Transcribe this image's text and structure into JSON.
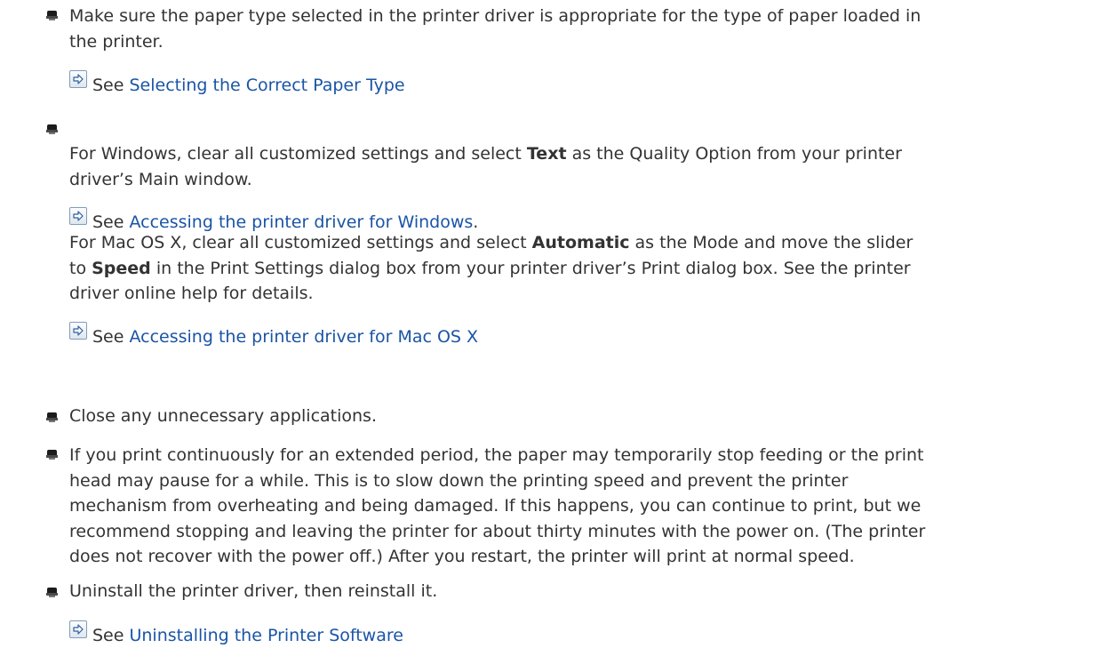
{
  "items": [
    {
      "text_line1": "Make sure the paper type selected in the printer driver is appropriate for the type of paper loaded in",
      "text_line2": "the printer.",
      "see_label": "See ",
      "link": "Selecting the Correct Paper Type"
    },
    {
      "windows_line1_a": "For Windows, clear all customized settings and select ",
      "windows_line1_bold": "Text",
      "windows_line1_b": " as the Quality Option from your printer",
      "windows_line2": "driver’s Main window.",
      "windows_see_label": "See ",
      "windows_link": "Accessing the printer driver for Windows",
      "windows_link_suffix": ".",
      "mac_line1_a": "For Mac OS X, clear all customized settings and select ",
      "mac_line1_bold": "Automatic",
      "mac_line1_b": " as the Mode and move the slider",
      "mac_line2_a": "to ",
      "mac_line2_bold": "Speed",
      "mac_line2_b": " in the Print Settings dialog box from your printer driver’s Print dialog box. See the printer",
      "mac_line3": "driver online help for details.",
      "mac_see_label": "See ",
      "mac_link": "Accessing the printer driver for Mac OS X"
    },
    {
      "text": "Close any unnecessary applications."
    },
    {
      "lines": [
        "If you print continuously for an extended period, the paper may temporarily stop feeding or the print",
        "head may pause for a while. This is to slow down the printing speed and prevent the printer",
        "mechanism from overheating and being damaged. If this happens, you can continue to print, but we",
        "recommend stopping and leaving the printer for about thirty minutes with the power on. (The printer",
        "does not recover with the power off.) After you restart, the printer will print at normal speed."
      ]
    },
    {
      "text": "Uninstall the printer driver, then reinstall it.",
      "see_label": "See ",
      "link": "Uninstalling the Printer Software"
    }
  ],
  "icons": {
    "bullet": "square-bullet-icon",
    "see": "arrow-right-icon"
  },
  "colors": {
    "text": "#333333",
    "link": "#1a54a6",
    "background": "#ffffff"
  }
}
